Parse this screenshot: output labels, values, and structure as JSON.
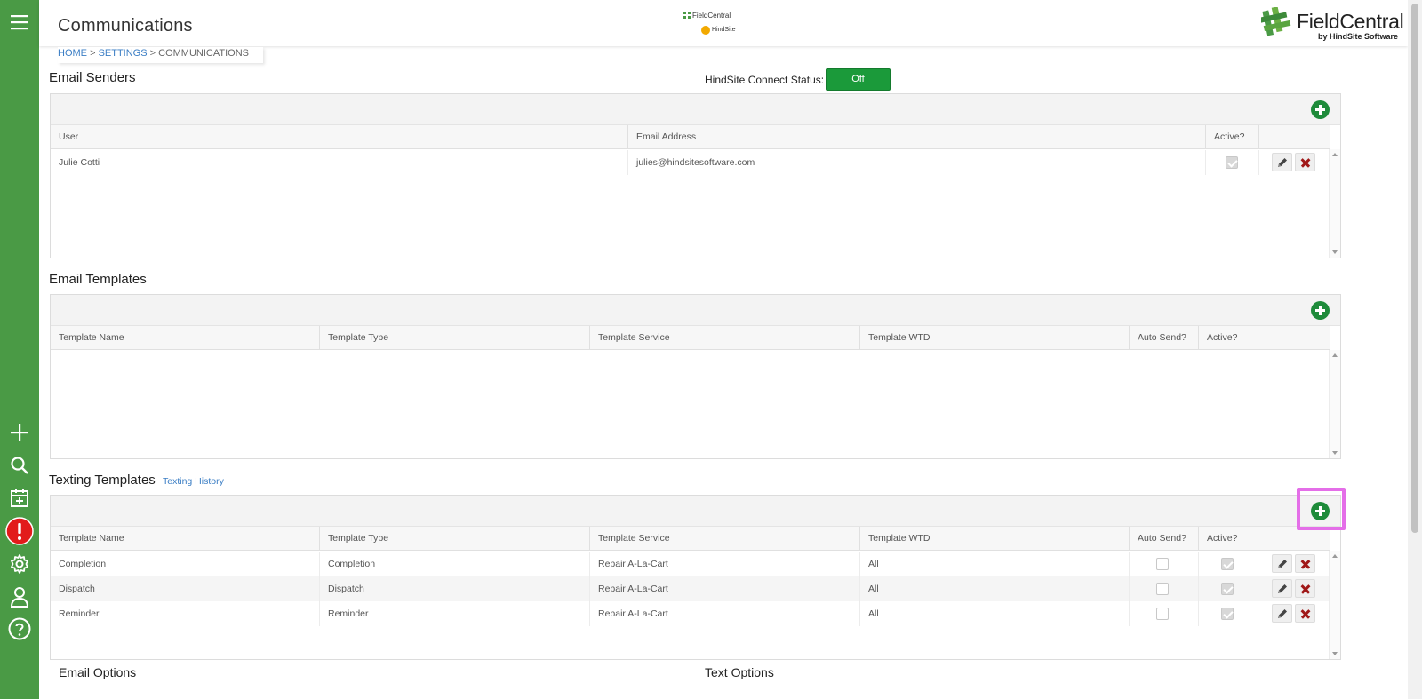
{
  "sidebar": {
    "icons": [
      "menu-icon",
      "plus-icon",
      "search-icon",
      "calendar-add-icon",
      "alert-icon",
      "gear-icon",
      "user-icon",
      "help-icon"
    ]
  },
  "header": {
    "title": "Communications",
    "breadcrumb": {
      "home": "HOME",
      "settings": "SETTINGS",
      "current": "COMMUNICATIONS",
      "sep": ">"
    },
    "center_logo": {
      "line1": "FieldCentral",
      "line2": "HindSite"
    },
    "logo": {
      "name": "FieldCentral",
      "sub": "by HindSite Software"
    }
  },
  "email_senders": {
    "title": "Email Senders",
    "status_label": "HindSite Connect Status:",
    "status_value": "Off",
    "columns": [
      "User",
      "Email Address",
      "Active?"
    ],
    "rows": [
      {
        "user": "Julie Cotti",
        "email": "julies@hindsitesoftware.com",
        "active": true
      }
    ]
  },
  "email_templates": {
    "title": "Email Templates",
    "columns": [
      "Template Name",
      "Template Type",
      "Template Service",
      "Template WTD",
      "Auto Send?",
      "Active?"
    ],
    "rows": []
  },
  "texting_templates": {
    "title": "Texting Templates",
    "history_link": "Texting History",
    "columns": [
      "Template Name",
      "Template Type",
      "Template Service",
      "Template WTD",
      "Auto Send?",
      "Active?"
    ],
    "rows": [
      {
        "name": "Completion",
        "type": "Completion",
        "service": "Repair A-La-Cart",
        "wtd": "All",
        "auto_send": false,
        "active": true
      },
      {
        "name": "Dispatch",
        "type": "Dispatch",
        "service": "Repair A-La-Cart",
        "wtd": "All",
        "auto_send": false,
        "active": true
      },
      {
        "name": "Reminder",
        "type": "Reminder",
        "service": "Repair A-La-Cart",
        "wtd": "All",
        "auto_send": false,
        "active": true
      }
    ]
  },
  "options": {
    "email": "Email Options",
    "text": "Text Options"
  },
  "colors": {
    "sidebar": "#4a9a45",
    "add_button": "#1e8b3a",
    "status_button": "#1b9a3a",
    "link": "#3a7dc4",
    "delete": "#a01818",
    "highlight": "#e46ee8"
  }
}
